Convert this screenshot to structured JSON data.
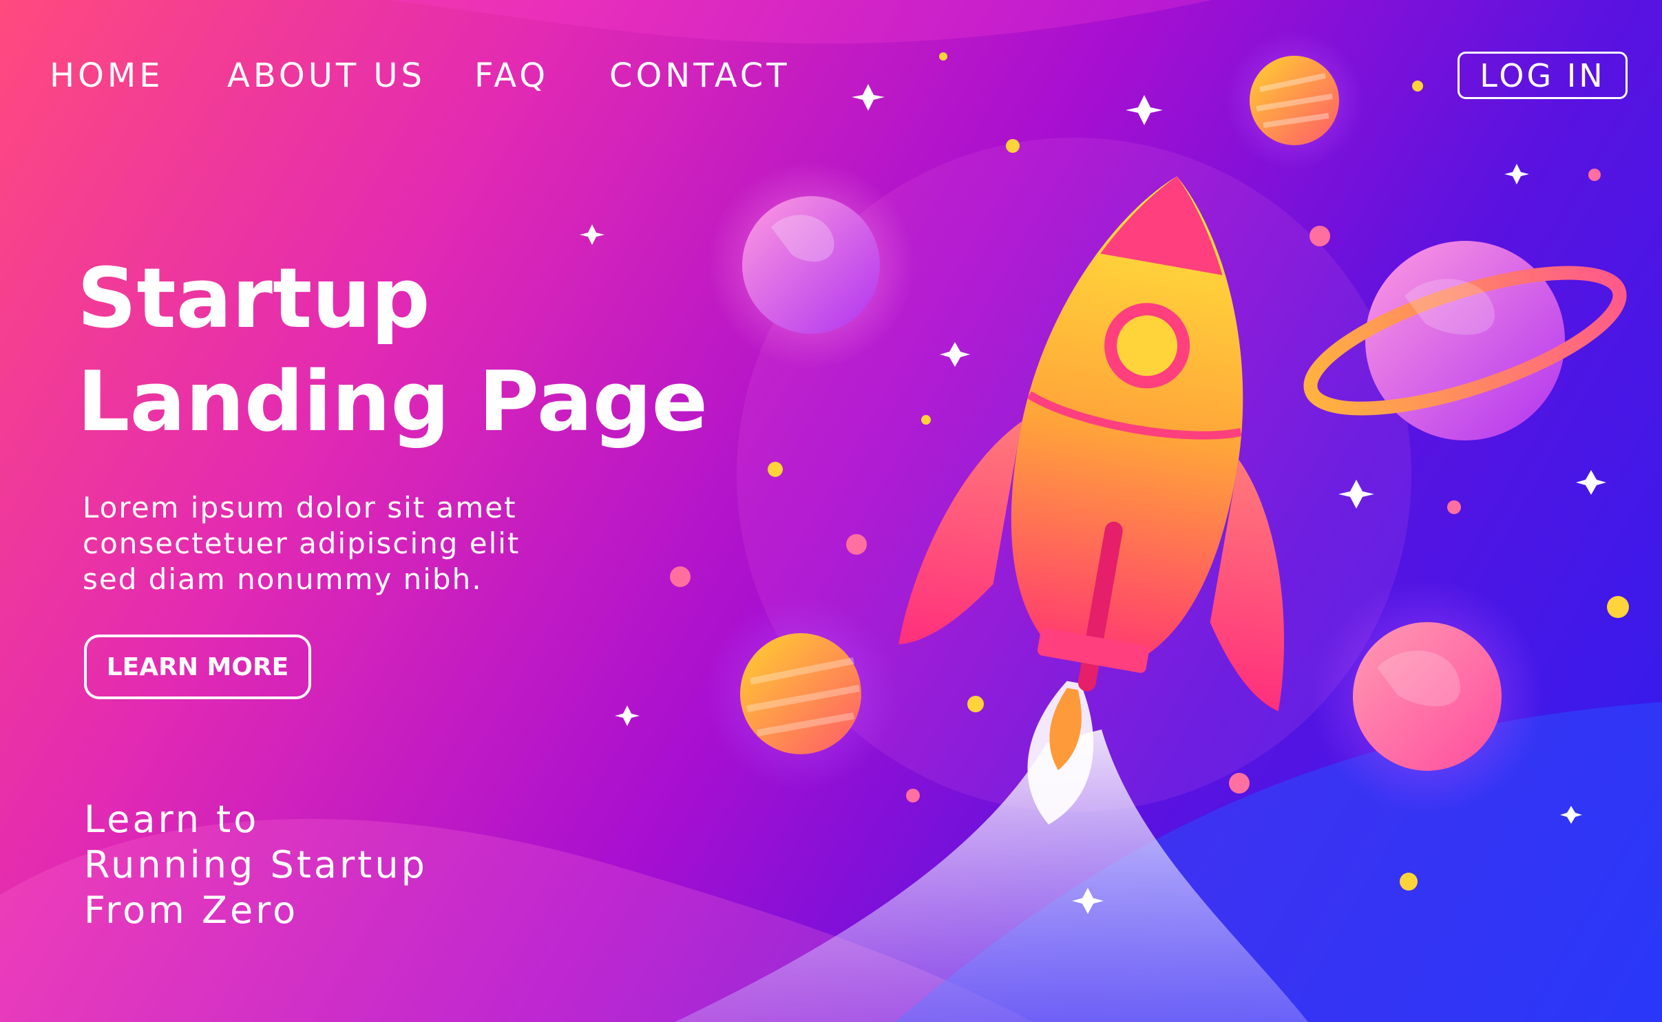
{
  "nav": {
    "links": [
      "HOME",
      "ABOUT US",
      "FAQ",
      "CONTACT"
    ],
    "login_label": "LOG IN"
  },
  "hero": {
    "title_lines": [
      "Startup",
      "Landing Page"
    ],
    "description_lines": [
      "Lorem ipsum dolor sit amet",
      "consectetuer adipiscing elit",
      "sed diam nonummy nibh."
    ],
    "button_label": "LEARN MORE",
    "tagline_lines": [
      "Learn to",
      "Running Startup",
      "From Zero"
    ]
  },
  "illustration": {
    "subject": "rocket-launch-icon",
    "elements": [
      "rocket-icon",
      "planet-icon",
      "ringed-planet-icon",
      "star-icon",
      "dot-icon"
    ]
  },
  "colors": {
    "gradient_start": "#ff4a7e",
    "gradient_mid": "#a80fd0",
    "gradient_end": "#2a1ef0",
    "rocket_yellow": "#ffd43a",
    "rocket_pink": "#ff3f7e",
    "text": "#ffffff"
  }
}
